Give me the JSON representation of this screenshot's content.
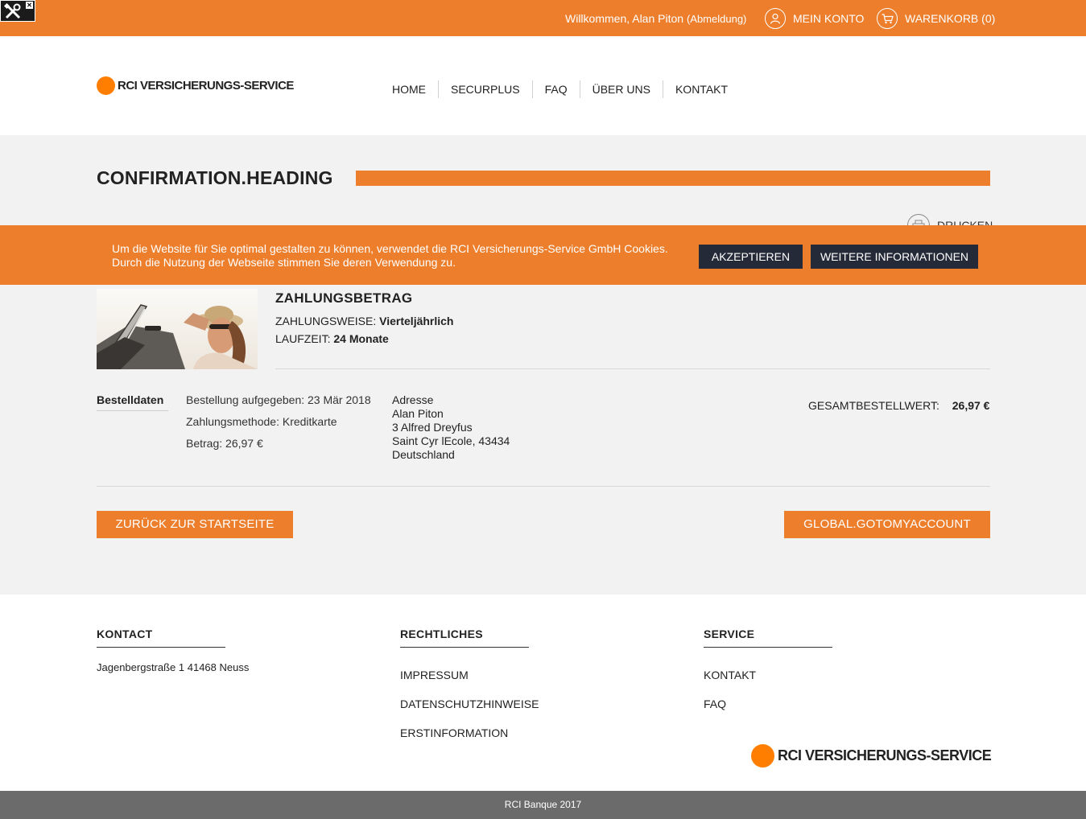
{
  "topbar": {
    "welcome": "Willkommen, Alan Piton",
    "logout": "(Abmeldung)",
    "account": "MEIN KONTO",
    "cart": "WARENKORB (0)"
  },
  "brand": {
    "name": "RCI VERSICHERUNGS-SERVICE",
    "accent": "#ec7e2c",
    "dark_button": "#252a38"
  },
  "nav": {
    "items": [
      "HOME",
      "SECURPLUS",
      "FAQ",
      "ÜBER UNS",
      "KONTAKT"
    ]
  },
  "page": {
    "heading": "CONFIRMATION.HEADING",
    "print": "DRUCKEN"
  },
  "cookie": {
    "line1": "Um die Website für Sie optimal gestalten zu können, verwendet die RCI Versicherungs-Service GmbH Cookies.",
    "line2": "Durch die Nutzung der Webseite stimmen Sie deren Verwendung zu.",
    "accept": "AKZEPTIEREN",
    "more": "WEITERE INFORMATIONEN"
  },
  "product": {
    "title": "ZAHLUNGSBETRAG",
    "payment_label": "ZAHLUNGSWEISE:",
    "payment_value": "Vierteljährlich",
    "term_label": "LAUFZEIT:",
    "term_value": "24 Monate"
  },
  "order": {
    "label": "Bestelldaten",
    "placed": "Bestellung aufgegeben: 23 Mär 2018",
    "method": "Zahlungsmethode: Kreditkarte",
    "amount": "Betrag: 26,97 €",
    "address": [
      "Adresse",
      "Alan Piton",
      "3 Alfred Dreyfus",
      "Saint Cyr lEcole, 43434",
      "Deutschland"
    ],
    "total_label": "GESAMTBESTELLWERT:",
    "total_value": "26,97 €"
  },
  "buttons": {
    "back": "ZURÜCK ZUR STARTSEITE",
    "account": "GLOBAL.GOTOMYACCOUNT"
  },
  "footer": {
    "kontakt_title": "KONTACT",
    "kontakt_address": "Jagenbergstraße 1 41468 Neuss",
    "legal_title": "RECHTLICHES",
    "legal_links": [
      "IMPRESSUM",
      "DATENSCHUTZHINWEISE",
      "ERSTINFORMATION"
    ],
    "service_title": "SERVICE",
    "service_links": [
      "KONTAKT",
      "FAQ"
    ],
    "copyright": "RCI Banque 2017"
  }
}
